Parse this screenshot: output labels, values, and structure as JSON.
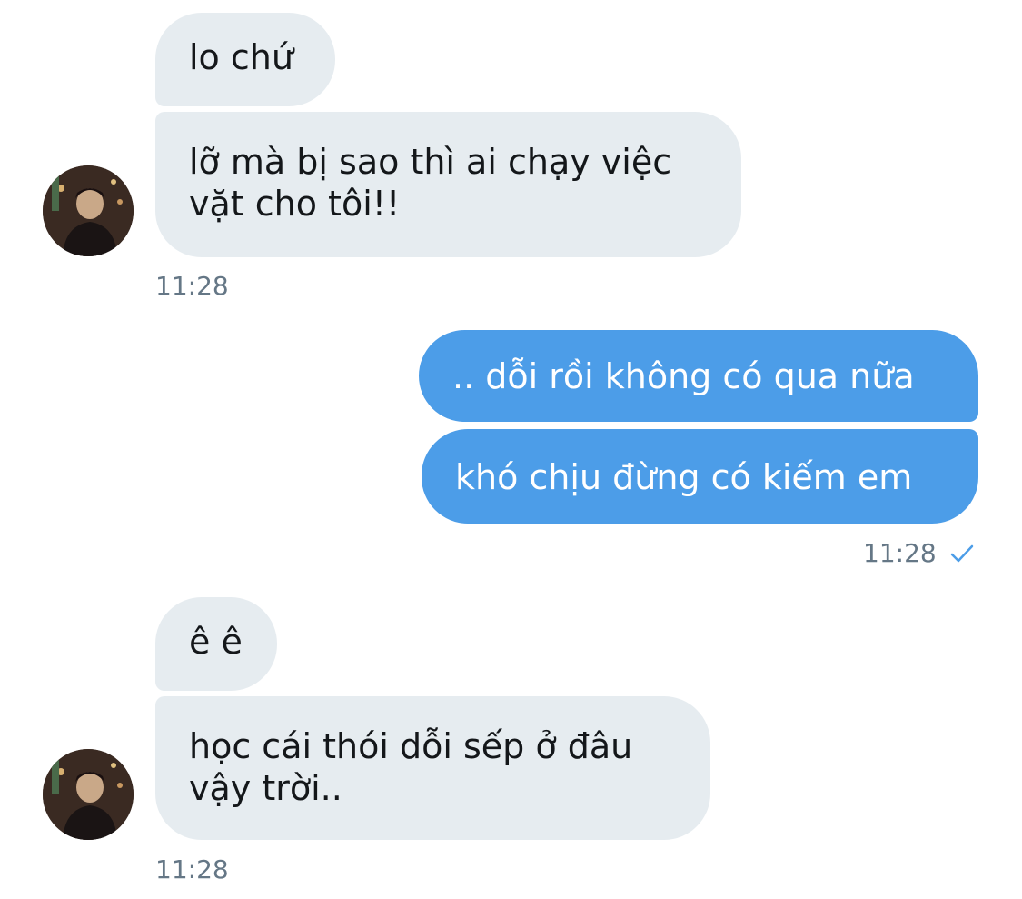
{
  "conversation": {
    "messages": [
      {
        "direction": "in",
        "text": "lo chứ"
      },
      {
        "direction": "in",
        "text_lines": [
          "lỡ mà bị sao thì ai chạy việc",
          "vặt cho tôi!!"
        ]
      },
      {
        "direction": "out",
        "text": ".. dỗi rồi không có qua nữa"
      },
      {
        "direction": "out",
        "text": "khó chịu đừng có kiếm em"
      },
      {
        "direction": "in",
        "text": "ê ê"
      },
      {
        "direction": "in",
        "text_lines": [
          "học cái thói dỗi sếp ở đâu",
          "vậy trời.."
        ]
      }
    ],
    "timestamps": {
      "group1": "11:28",
      "group2": "11:28",
      "group3": "11:28"
    },
    "read_status_icon": "checkmark-icon",
    "colors": {
      "incoming_bubble": "#e6ecf0",
      "outgoing_bubble": "#4c9de8",
      "timestamp": "#657786",
      "check": "#4c9de8"
    }
  }
}
